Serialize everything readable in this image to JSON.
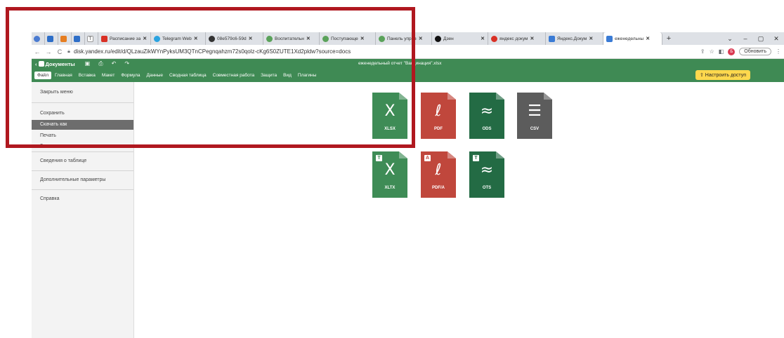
{
  "browser": {
    "tabs": [
      {
        "title": "",
        "color": "#4a7bd1",
        "close": ""
      },
      {
        "title": "",
        "color": "#2d6ec8",
        "close": ""
      },
      {
        "title": "",
        "color": "#e67e22",
        "close": ""
      },
      {
        "title": "",
        "color": "#2d6ec8",
        "close": ""
      },
      {
        "title": "T",
        "color": "#ffffff",
        "close": ""
      },
      {
        "title": "Расписание за",
        "color": "#d93025",
        "close": "✕"
      },
      {
        "title": "Telegram Web",
        "color": "#2aa3e0",
        "close": "✕"
      },
      {
        "title": "08e579c6-59d",
        "color": "#333333",
        "close": "✕"
      },
      {
        "title": "Воспитательн",
        "color": "#5aa25a",
        "close": "✕"
      },
      {
        "title": "Поступающе",
        "color": "#5aa25a",
        "close": "✕"
      },
      {
        "title": "Панель управ",
        "color": "#5aa25a",
        "close": "✕"
      },
      {
        "title": "Дзен",
        "color": "#111111",
        "close": "✕"
      },
      {
        "title": "яндекс докум",
        "color": "#d93025",
        "close": "✕"
      },
      {
        "title": "Яндекс.Докум",
        "color": "#3a7bd5",
        "close": "✕"
      },
      {
        "title": "еженедельны",
        "color": "#3a7bd5",
        "close": "✕",
        "active": true
      }
    ],
    "new_tab": "+",
    "window_controls": [
      "⌄",
      "–",
      "▢",
      "✕"
    ],
    "url": "disk.yandex.ru/edit/d/QLzauZikWYnPyksUM3QTnCPegnqahzm72s0qolz-cKg6S0ZUTE1Xd2pldw?source=docs",
    "update_button": "Обновить",
    "avatar_letter": "Б"
  },
  "app": {
    "logo_text": "Документы",
    "doc_title": "еженедельный отчет \"Вакцинация\".xlsx",
    "menu": [
      "Файл",
      "Главная",
      "Вставка",
      "Макет",
      "Формула",
      "Данные",
      "Сводная таблица",
      "Совместная работа",
      "Защита",
      "Вид",
      "Плагины"
    ],
    "active_menu": "Файл",
    "share_button": "Настроить доступ"
  },
  "sidebar": {
    "close_menu": "Закрыть меню",
    "save": "Сохранить",
    "download_as": "Скачать как",
    "print": "Печать",
    "protect": "Защитить",
    "table_info": "Сведения о таблице",
    "advanced": "Дополнительные параметры",
    "help": "Справка"
  },
  "formats": [
    {
      "label": "XLSX",
      "color": "#3e8c56",
      "glyph": "X",
      "badge": ""
    },
    {
      "label": "PDF",
      "color": "#c0473c",
      "glyph": "ℓ",
      "badge": ""
    },
    {
      "label": "ODS",
      "color": "#236b44",
      "glyph": "≈",
      "badge": ""
    },
    {
      "label": "CSV",
      "color": "#5c5c5c",
      "glyph": "☰",
      "badge": ""
    },
    {
      "label": "XLTX",
      "color": "#3e8c56",
      "glyph": "X",
      "badge": "T"
    },
    {
      "label": "PDF/A",
      "color": "#c0473c",
      "glyph": "ℓ",
      "badge": "A"
    },
    {
      "label": "OTS",
      "color": "#236b44",
      "glyph": "≈",
      "badge": "T"
    }
  ],
  "colors": {
    "accent_green": "#3f8a54",
    "annotation_red": "#b0181f",
    "share_yellow": "#ffd84d"
  }
}
